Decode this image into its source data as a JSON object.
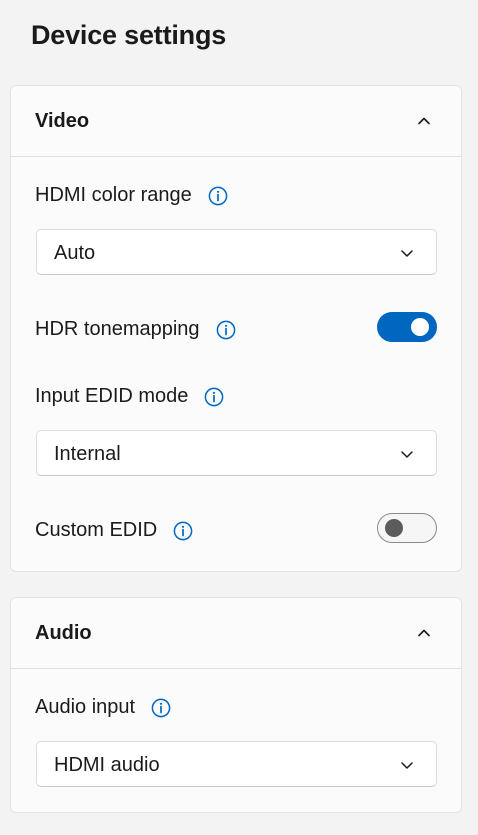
{
  "page": {
    "title": "Device settings"
  },
  "colors": {
    "accent": "#0067c0",
    "info_icon": "#0067c0"
  },
  "video": {
    "title": "Video",
    "hdmi_color_range": {
      "label": "HDMI color range",
      "value": "Auto"
    },
    "hdr_tonemapping": {
      "label": "HDR tonemapping",
      "state": "on"
    },
    "input_edid_mode": {
      "label": "Input EDID mode",
      "value": "Internal"
    },
    "custom_edid": {
      "label": "Custom EDID",
      "state": "off"
    }
  },
  "audio": {
    "title": "Audio",
    "audio_input": {
      "label": "Audio input",
      "value": "HDMI audio"
    }
  },
  "icons": {
    "info": "info-icon",
    "collapse": "chevron-up-icon",
    "dropdown": "chevron-down-icon"
  }
}
